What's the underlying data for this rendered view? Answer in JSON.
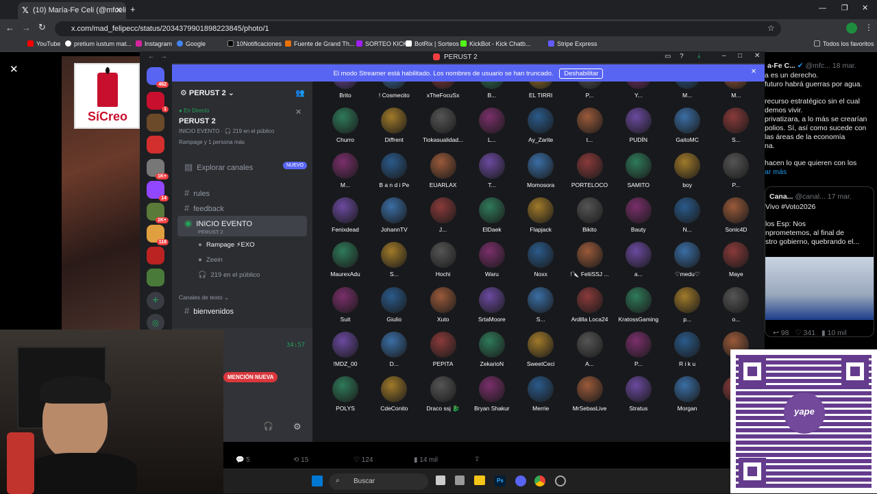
{
  "browser": {
    "tab_title": "(10) María-Fe Celi (@mfceli) / X",
    "url": "x.com/mad_felipecc/status/2034379901898223845/photo/1"
  },
  "bookmarks": [
    "YouTube",
    "pretium iustum mat...",
    "Instagram",
    "Google",
    "10Notificaciones",
    "Fuente de Grand Th...",
    "SORTEO KICK",
    "BotRix | Sorteos",
    "KickBot - Kick Chatb...",
    "Stripe Express",
    "Todos los favoritos"
  ],
  "discord": {
    "window_title": "PERUST 2",
    "streamer_banner": "El modo Streamer está habilitado. Los nombres de usuario se han truncado.",
    "disable_button": "Deshabilitar",
    "server_name": "PERUST 2",
    "live_label": "En Directo",
    "live_title": "PERUST 2",
    "live_sub": "INICIO EVENTO · 🎧 219 en el público",
    "live_people": "Rampage y 1 persona más",
    "explore": "Explorar canales",
    "explore_badge": "NUEVO",
    "channels": [
      "rules",
      "feedback"
    ],
    "stage_channel": "INICIO EVENTO",
    "stage_sub": "PERUST 2",
    "stage_members": [
      "Rampage ⚡EXO",
      "Zeein"
    ],
    "audience": "219 en el público",
    "text_category": "Canales de texto",
    "text_channel": "bienvenidos",
    "timer": "34:57",
    "mention": "MENCIÓN NUEVA",
    "home_badge": "462",
    "guild_badges": [
      "1",
      "1K+",
      "1K+",
      "14",
      "1K+",
      "118"
    ]
  },
  "audience_grid": [
    [
      "Brito",
      "! Cosmecito",
      "xTheFocuSx",
      "B...",
      "EL TIRRI",
      "P...",
      "Y...",
      "M...",
      "M..."
    ],
    [
      "Churro",
      "Diffrent",
      "Tiokasualidad...",
      "L...",
      "Ay_Zarite",
      "t...",
      "PUDÍN",
      "GaitoMC",
      "S..."
    ],
    [
      "M...",
      "B a n d i Pe",
      "EUARLAX",
      "T...",
      "Momosora",
      "PORTELOCO",
      "SAMITO",
      "boy",
      "P..."
    ],
    [
      "Fenixdead",
      "JohannTV",
      "J...",
      "ElDaek",
      "Flapjack",
      "Bikito",
      "Bauty",
      "N...",
      "Sonic4D"
    ],
    [
      "MaurexAdu",
      "S...",
      "Hochi",
      "Waru",
      "Noxx",
      "!🔪 FeliiSSJ ...",
      "a...",
      "♡medu♡",
      "Maye"
    ],
    [
      "Suit",
      "Giulio",
      "Xuto",
      "SrtaMoore",
      "S...",
      "Ardilla Loca24",
      "KratossGaming",
      "p...",
      "o..."
    ],
    [
      "!MDZ_00",
      "D...",
      "PEPITA",
      "ZekarioN",
      "SweetCeci",
      "A...",
      "P...",
      "R i k u",
      "X..."
    ],
    [
      "POLYS",
      "CdeConito",
      "Draco ssj 🐉",
      "Bryan Shakur",
      "Merrie",
      "MrSebasLive",
      "Stratus",
      "Morgan",
      "n..."
    ]
  ],
  "tweet_right": {
    "author": "a-Fe C...",
    "handle": "@mfc...",
    "date": "18 mar.",
    "lines": [
      "a es un derecho.",
      "futuro habrá guerras por agua.",
      "recurso estratégico sin el cual",
      "demos vivir.",
      "privatizara, a lo más se crearían",
      "polios. Sí, así como sucede con",
      "las áreas de la economía",
      "na.",
      "hacen lo que quieren con los",
      "ar más"
    ]
  },
  "quote": {
    "author": "Cana...",
    "handle": "@canal...",
    "date": "17 mar.",
    "lines": [
      "Vivo #Voto2026",
      "los Esp: Nos",
      "nprometemos, al final de",
      "stro gobierno, quebrando el..."
    ]
  },
  "quote_stats": {
    "replies": "98",
    "likes": "341",
    "views": "10 mil"
  },
  "tweet_stats": {
    "replies": "5",
    "retweets": "15",
    "likes": "124",
    "views": "14 mil"
  },
  "overlay": {
    "logo": "SíCreo",
    "qr_brand": "yape"
  },
  "taskbar": {
    "search": "Buscar"
  }
}
